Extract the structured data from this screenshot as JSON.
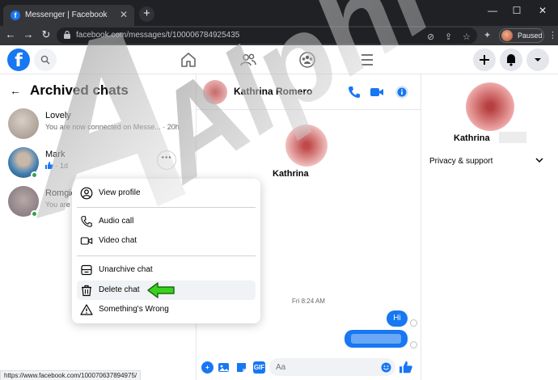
{
  "browser": {
    "tab_title": "Messenger | Facebook",
    "url": "facebook.com/messages/t/100006784925435",
    "profile_status": "Paused",
    "status_url": "https://www.facebook.com/100070637894975/"
  },
  "archived": {
    "title": "Archived chats",
    "chats": [
      {
        "name": "Lovely",
        "preview": "You are now connected on Messe... · 20h"
      },
      {
        "name": "Mark",
        "preview": "· 1d"
      },
      {
        "name": "Romgie",
        "preview": "You are n"
      }
    ]
  },
  "context_menu": {
    "items": [
      "View profile",
      "Audio call",
      "Video chat",
      "Unarchive chat",
      "Delete chat",
      "Something's Wrong"
    ]
  },
  "conversation": {
    "header_name": "Kathrina Romero",
    "profile_name": "Kathrina",
    "timestamp": "Fri 8:24 AM",
    "message_hi": "Hi",
    "composer_placeholder": "Aa",
    "gif_label": "GIF"
  },
  "right_panel": {
    "name": "Kathrina",
    "privacy_label": "Privacy & support"
  },
  "watermark": {
    "text": "Alphr"
  },
  "colors": {
    "accent": "#1877f2",
    "arrow": "#39d11d",
    "online": "#31a24c"
  }
}
